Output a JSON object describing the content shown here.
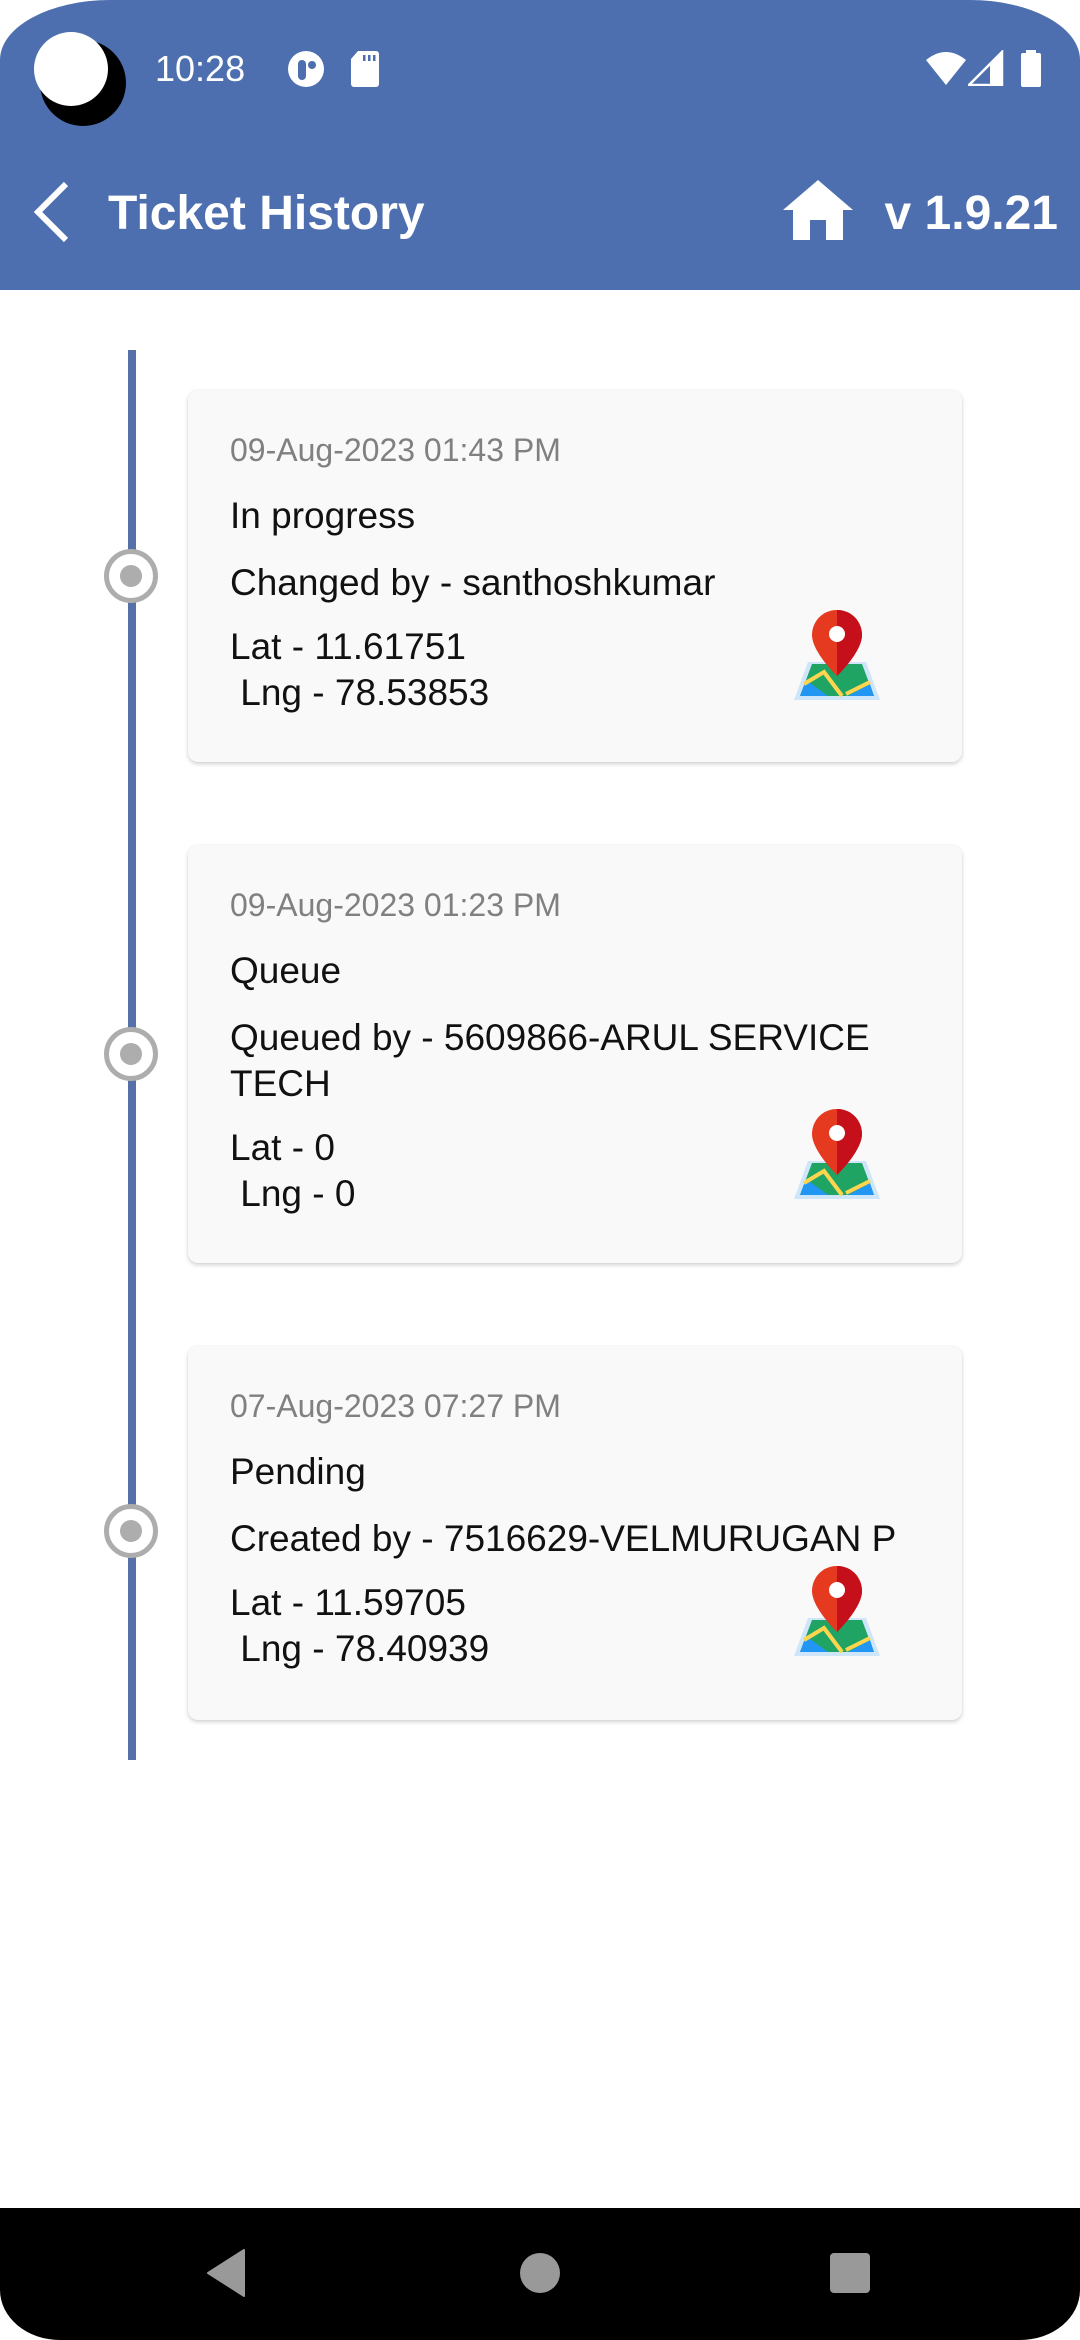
{
  "status_bar": {
    "time": "10:28",
    "left_icons": [
      "notification-app-icon",
      "sd-card-icon"
    ],
    "right_icons": [
      "wifi-icon",
      "cell-signal-icon",
      "battery-icon"
    ]
  },
  "toolbar": {
    "back_icon": "chevron-left-icon",
    "title": "Ticket History",
    "home_icon": "home-icon",
    "version": "v 1.9.21"
  },
  "colors": {
    "header": "#4D6EAF",
    "timeline": "#5670A8",
    "node": "#ADADAD",
    "card_bg": "#F9F9F9",
    "date_text": "#808080",
    "nav_bar": "#000000"
  },
  "history": [
    {
      "date": "09-Aug-2023 01:43 PM",
      "status": "In progress",
      "actor": "Changed by - santhoshkumar",
      "lat": "Lat - 11.61751",
      "lng": " Lng - 78.53853",
      "map_icon": "map-pin-icon"
    },
    {
      "date": "09-Aug-2023 01:23 PM",
      "status": "Queue",
      "actor": "Queued by - 5609866-ARUL SERVICE TECH",
      "lat": "Lat - 0",
      "lng": " Lng - 0",
      "map_icon": "map-pin-icon"
    },
    {
      "date": "07-Aug-2023 07:27 PM",
      "status": "Pending",
      "actor": "Created by - 7516629-VELMURUGAN P",
      "lat": "Lat - 11.59705",
      "lng": " Lng - 78.40939",
      "map_icon": "map-pin-icon"
    }
  ],
  "nav_bar": {
    "buttons": [
      "back",
      "home",
      "recents"
    ]
  }
}
